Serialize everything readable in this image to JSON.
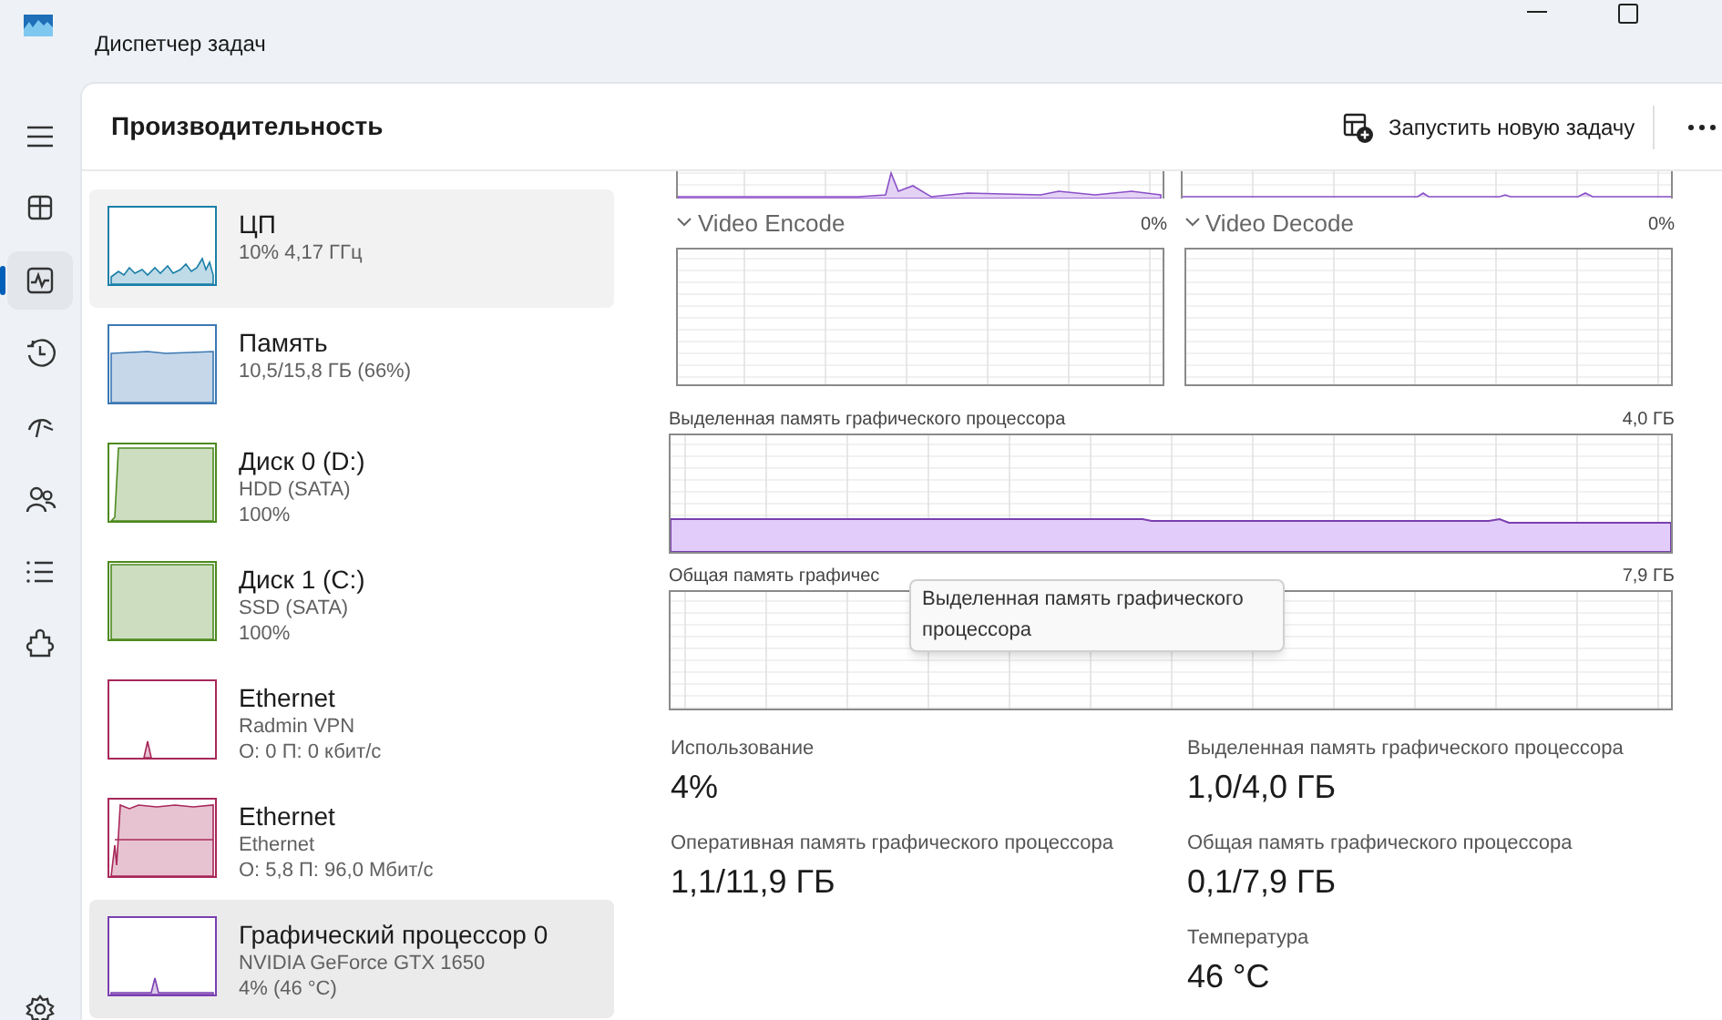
{
  "window": {
    "title": "Диспетчер задач"
  },
  "nav": [
    {
      "kind": "menu",
      "selected": false
    },
    {
      "kind": "processes",
      "selected": false
    },
    {
      "kind": "performance",
      "selected": true
    },
    {
      "kind": "history",
      "selected": false
    },
    {
      "kind": "startup",
      "selected": false
    },
    {
      "kind": "users",
      "selected": false
    },
    {
      "kind": "details",
      "selected": false
    },
    {
      "kind": "services",
      "selected": false
    },
    {
      "kind": "settings",
      "selected": false
    }
  ],
  "page": {
    "title": "Производительность",
    "run_task_button": "Запустить новую задачу"
  },
  "devices": [
    {
      "kind": "cpu",
      "name": "ЦП",
      "details": [
        "10% 4,17 ГГц"
      ],
      "color": "#1a7fa8",
      "selected": false,
      "hovered": true
    },
    {
      "kind": "memory",
      "name": "Память",
      "details": [
        "10,5/15,8 ГБ (66%)"
      ],
      "color": "#3c78b4",
      "selected": false,
      "hovered": false
    },
    {
      "kind": "disk",
      "name": "Диск 0 (D:)",
      "details": [
        "HDD (SATA)",
        "100%"
      ],
      "color": "#4d8a1e",
      "selected": false,
      "hovered": false
    },
    {
      "kind": "disk-flat",
      "name": "Диск 1 (C:)",
      "details": [
        "SSD (SATA)",
        "100%"
      ],
      "color": "#4d8a1e",
      "selected": false,
      "hovered": false
    },
    {
      "kind": "net-idle",
      "name": "Ethernet",
      "details": [
        "Radmin VPN",
        "О: 0 П: 0 кбит/с"
      ],
      "color": "#a8285a",
      "selected": false,
      "hovered": false
    },
    {
      "kind": "net-busy",
      "name": "Ethernet",
      "details": [
        "Ethernet",
        "О: 5,8 П: 96,0 Мбит/с"
      ],
      "color": "#a8285a",
      "selected": false,
      "hovered": false
    },
    {
      "kind": "gpu",
      "name": "Графический процессор 0",
      "details": [
        "NVIDIA GeForce GTX 1650",
        "4% (46 °C)"
      ],
      "color": "#7a3fb0",
      "selected": true,
      "hovered": false
    }
  ],
  "engines": [
    {
      "name": "Video Encode",
      "value": "0%"
    },
    {
      "name": "Video Decode",
      "value": "0%"
    }
  ],
  "dedicated_memory": {
    "label": "Выделенная память графического процессора",
    "max": "4,0 ГБ"
  },
  "shared_memory": {
    "label": "Общая память графичес",
    "max": "7,9 ГБ"
  },
  "tooltip": "Выделенная память графического процессора",
  "stats_left": [
    {
      "label": "Использование",
      "value": "4%"
    },
    {
      "label": "Оперативная память графического процессора",
      "value": "1,1/11,9 ГБ"
    }
  ],
  "stats_right": [
    {
      "label": "Выделенная память графического процессора",
      "value": "1,0/4,0 ГБ"
    },
    {
      "label": "Общая память графического процессора",
      "value": "0,1/7,9 ГБ"
    },
    {
      "label": "Температура",
      "value": "46 °C"
    }
  ]
}
